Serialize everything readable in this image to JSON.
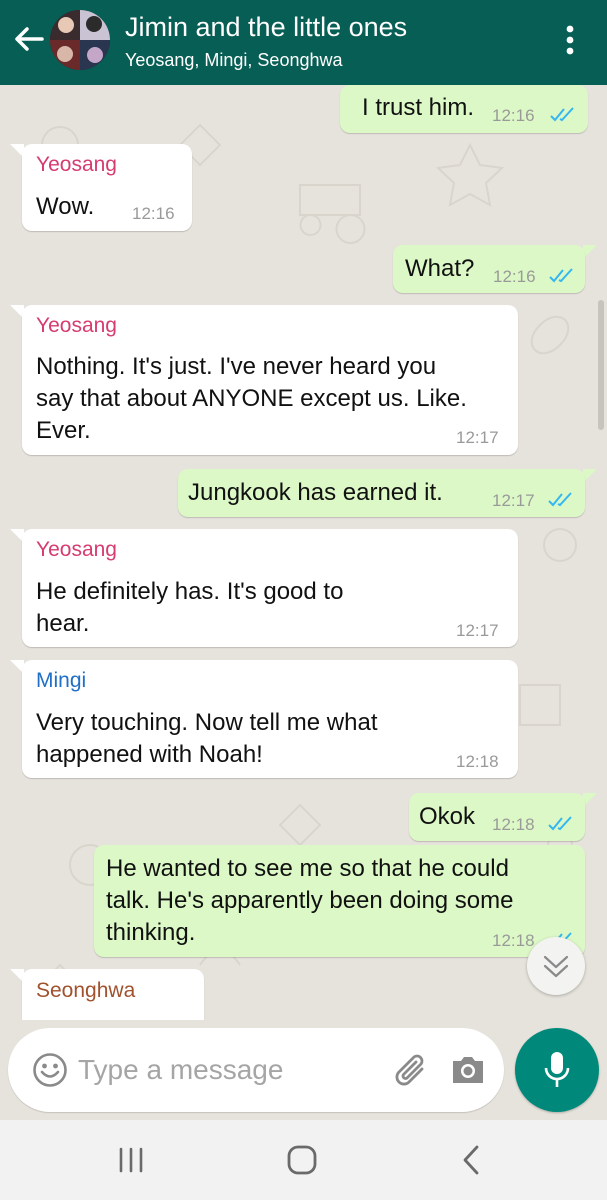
{
  "header": {
    "title": "Jimin and the little ones",
    "subtitle": "Yeosang, Mingi, Seonghwa",
    "color": "#075e54"
  },
  "messages": [
    {
      "direction": "out",
      "text": "I trust him.",
      "time": "12:16",
      "status": "read"
    },
    {
      "direction": "in",
      "sender": "Yeosang",
      "sender_color": "#d63c6f",
      "text": "Wow.",
      "time": "12:16"
    },
    {
      "direction": "out",
      "text": "What?",
      "time": "12:16",
      "status": "read"
    },
    {
      "direction": "in",
      "sender": "Yeosang",
      "sender_color": "#d63c6f",
      "lines": [
        "Nothing. It's just. I've never heard you",
        "say that about ANYONE except us. Like.",
        "Ever."
      ],
      "time": "12:17"
    },
    {
      "direction": "out",
      "text": "Jungkook has earned it.",
      "time": "12:17",
      "status": "read"
    },
    {
      "direction": "in",
      "sender": "Yeosang",
      "sender_color": "#d63c6f",
      "lines": [
        "He definitely has. It's good to",
        "hear."
      ],
      "time": "12:17"
    },
    {
      "direction": "in",
      "sender": "Mingi",
      "sender_color": "#1f6fc7",
      "lines": [
        "Very touching. Now tell me what",
        "happened with Noah!"
      ],
      "time": "12:18"
    },
    {
      "direction": "out",
      "text": "Okok",
      "time": "12:18",
      "status": "read"
    },
    {
      "direction": "out",
      "lines": [
        "He wanted to see me so that he could",
        "talk. He's apparently been doing some",
        "thinking."
      ],
      "time": "12:18",
      "status": "read"
    },
    {
      "direction": "in",
      "sender": "Seonghwa",
      "sender_color": "#a0522d",
      "partial": true
    }
  ],
  "input": {
    "placeholder": "Type a message"
  },
  "icons": {
    "back": "arrow-left-icon",
    "menu": "more-vertical-icon",
    "emoji": "smiley-icon",
    "attach": "paperclip-icon",
    "camera": "camera-icon",
    "mic": "microphone-icon",
    "scroll_down": "double-chevron-down-icon",
    "read_receipt": "double-check-icon"
  },
  "colors": {
    "incoming_bubble": "#ffffff",
    "outgoing_bubble": "#dcf8c6",
    "read_tick": "#34b7f1",
    "mic_button": "#00897b"
  }
}
